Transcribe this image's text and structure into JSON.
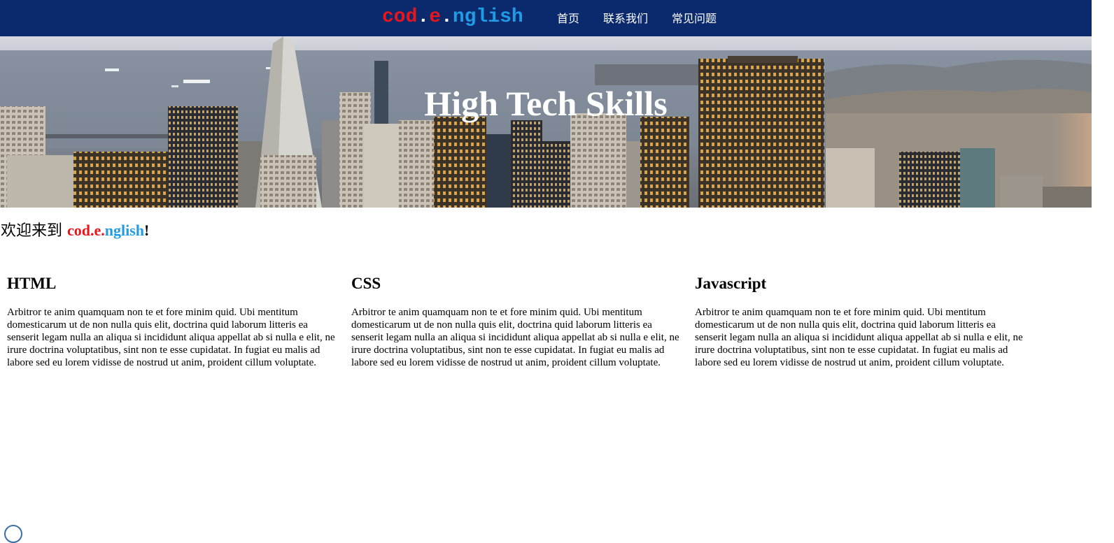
{
  "header": {
    "logo": {
      "part1": "cod",
      "dot1": ".",
      "part2": "e",
      "dot2": ".",
      "part3": "nglish"
    },
    "nav": [
      "首页",
      "联系我们",
      "常见问题"
    ]
  },
  "hero": {
    "title": "High Tech Skills"
  },
  "welcome": {
    "prefix": "欢迎来到 ",
    "brand_red": "cod.e.",
    "brand_blue": "nglish",
    "suffix": "!"
  },
  "columns": [
    {
      "title": "HTML",
      "text": "Arbitror te anim quamquam non te et fore minim quid. Ubi mentitum domesticarum ut de non nulla quis elit, doctrina quid laborum litteris ea senserit legam nulla an aliqua si incididunt aliqua appellat ab si nulla e elit, ne irure doctrina voluptatibus, sint non te esse cupidatat. In fugiat eu malis ad labore sed eu lorem vidisse de nostrud ut anim, proident cillum voluptate."
    },
    {
      "title": "CSS",
      "text": "Arbitror te anim quamquam non te et fore minim quid. Ubi mentitum domesticarum ut de non nulla quis elit, doctrina quid laborum litteris ea senserit legam nulla an aliqua si incididunt aliqua appellat ab si nulla e elit, ne irure doctrina voluptatibus, sint non te esse cupidatat. In fugiat eu malis ad labore sed eu lorem vidisse de nostrud ut anim, proident cillum voluptate."
    },
    {
      "title": "Javascript",
      "text": "Arbitror te anim quamquam non te et fore minim quid. Ubi mentitum domesticarum ut de non nulla quis elit, doctrina quid laborum litteris ea senserit legam nulla an aliqua si incididunt aliqua appellat ab si nulla e elit, ne irure doctrina voluptatibus, sint non te esse cupidatat. In fugiat eu malis ad labore sed eu lorem vidisse de nostrud ut anim, proident cillum voluptate."
    }
  ],
  "colors": {
    "header_bg": "#0b2a6e",
    "brand_red": "#e8161b",
    "brand_blue": "#1e9ce6",
    "text": "#000000"
  }
}
